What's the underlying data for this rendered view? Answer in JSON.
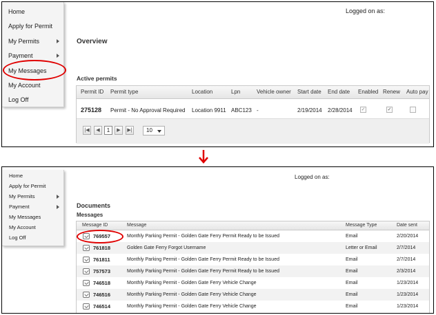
{
  "top": {
    "menu": [
      {
        "label": "Home",
        "submenu": false
      },
      {
        "label": "Apply for Permit",
        "submenu": false
      },
      {
        "label": "My Permits",
        "submenu": true
      },
      {
        "label": "Payment",
        "submenu": true
      },
      {
        "label": "My Messages",
        "submenu": false
      },
      {
        "label": "My Account",
        "submenu": false
      },
      {
        "label": "Log Off",
        "submenu": false
      }
    ],
    "logged_on": "Logged on as:",
    "overview": "Overview",
    "active_permits": "Active permits",
    "columns": [
      "Permit ID",
      "Permit type",
      "Location",
      "Lpn",
      "Vehicle owner",
      "Start date",
      "End date",
      "Enabled",
      "Renew",
      "Auto pay"
    ],
    "permit": {
      "id": "275128",
      "type": "Permit - No Approval Required",
      "location": "Location 9911",
      "lpn": "ABC123",
      "owner": "-",
      "start": "2/19/2014",
      "end": "2/28/2014",
      "enabled": "✓",
      "renew": "✓"
    },
    "pager": {
      "page": "1",
      "page_size": "10"
    }
  },
  "bottom": {
    "menu": [
      {
        "label": "Home",
        "submenu": false
      },
      {
        "label": "Apply for Permit",
        "submenu": false
      },
      {
        "label": "My Permits",
        "submenu": true
      },
      {
        "label": "Payment",
        "submenu": true
      },
      {
        "label": "My Messages",
        "submenu": false
      },
      {
        "label": "My Account",
        "submenu": false
      },
      {
        "label": "Log Off",
        "submenu": false
      }
    ],
    "logged_on": "Logged on as:",
    "documents": "Documents",
    "messages_title": "Messages",
    "columns": [
      "Message ID",
      "Message",
      "Message Type",
      "Date sent"
    ],
    "rows": [
      {
        "id": "769557",
        "message": "Monthly Parking Permit - Golden Gate Ferry Permit Ready to be Issued",
        "type": "Email",
        "date": "2/20/2014"
      },
      {
        "id": "761818",
        "message": "Golden Gate Ferry Forgot Username",
        "type": "Letter or Email",
        "date": "2/7/2014"
      },
      {
        "id": "761811",
        "message": "Monthly Parking Permit - Golden Gate Ferry Permit Ready to be Issued",
        "type": "Email",
        "date": "2/7/2014"
      },
      {
        "id": "757573",
        "message": "Monthly Parking Permit - Golden Gate Ferry Permit Ready to be Issued",
        "type": "Email",
        "date": "2/3/2014"
      },
      {
        "id": "746518",
        "message": "Monthly Parking Permit - Golden Gate Ferry Vehicle Change",
        "type": "Email",
        "date": "1/23/2014"
      },
      {
        "id": "746516",
        "message": "Monthly Parking Permit - Golden Gate Ferry Vehicle Change",
        "type": "Email",
        "date": "1/23/2014"
      },
      {
        "id": "746514",
        "message": "Monthly Parking Permit - Golden Gate Ferry Vehicle Change",
        "type": "Email",
        "date": "1/23/2014"
      }
    ]
  },
  "colors": {
    "highlight": "#e00000",
    "border": "#000000"
  }
}
